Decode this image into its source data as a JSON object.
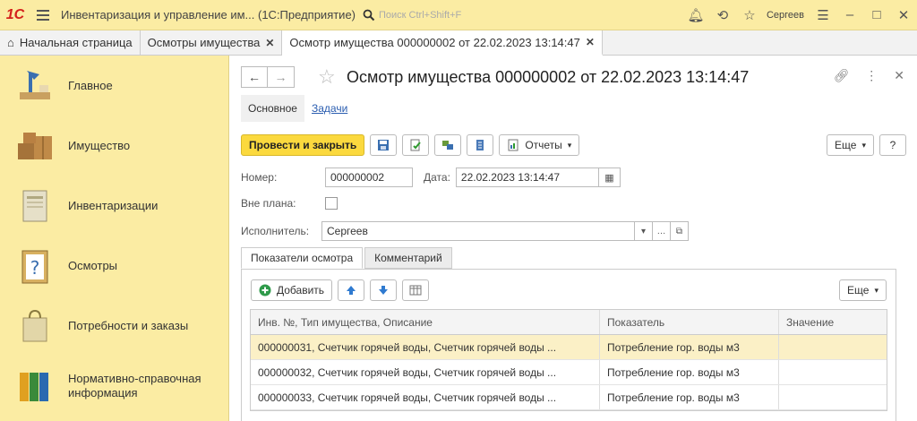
{
  "titlebar": {
    "logo": "1С",
    "app_title": "Инвентаризация и управление им...  (1С:Предприятие)",
    "search_placeholder": "Поиск Ctrl+Shift+F",
    "user": "Сергеев"
  },
  "tabs": [
    {
      "label": "Начальная страница"
    },
    {
      "label": "Осмотры имущества"
    },
    {
      "label": "Осмотр имущества 000000002 от 22.02.2023 13:14:47"
    }
  ],
  "sidebar": {
    "items": [
      {
        "label": "Главное"
      },
      {
        "label": "Имущество"
      },
      {
        "label": "Инвентаризации"
      },
      {
        "label": "Осмотры"
      },
      {
        "label": "Потребности и заказы"
      },
      {
        "label": "Нормативно-справочная информация"
      }
    ]
  },
  "document": {
    "title": "Осмотр имущества 000000002 от 22.02.2023 13:14:47",
    "subtabs": {
      "main": "Основное",
      "tasks": "Задачи"
    },
    "toolbar": {
      "post_close": "Провести и закрыть",
      "reports": "Отчеты",
      "more": "Еще",
      "help": "?"
    },
    "fields": {
      "number_label": "Номер:",
      "number_value": "000000002",
      "date_label": "Дата:",
      "date_value": "22.02.2023 13:14:47",
      "unplanned_label": "Вне плана:",
      "executor_label": "Исполнитель:",
      "executor_value": "Сергеев"
    },
    "page_tabs": {
      "indicators": "Показатели осмотра",
      "comment": "Комментарий"
    },
    "table_toolbar": {
      "add": "Добавить",
      "more": "Еще"
    },
    "table": {
      "columns": [
        "Инв. №, Тип имущества, Описание",
        "Показатель",
        "Значение"
      ],
      "rows": [
        [
          "000000031, Счетчик горячей воды, Счетчик горячей воды ...",
          "Потребление гор. воды м3",
          ""
        ],
        [
          "000000032, Счетчик горячей воды, Счетчик горячей воды ...",
          "Потребление гор. воды м3",
          ""
        ],
        [
          "000000033, Счетчик горячей воды, Счетчик горячей воды ...",
          "Потребление гор. воды м3",
          ""
        ]
      ]
    }
  },
  "colors": {
    "accent": "#fbd93e",
    "sidebar": "#fbeca3",
    "link": "#2a5db0",
    "logo": "#d4201b"
  }
}
